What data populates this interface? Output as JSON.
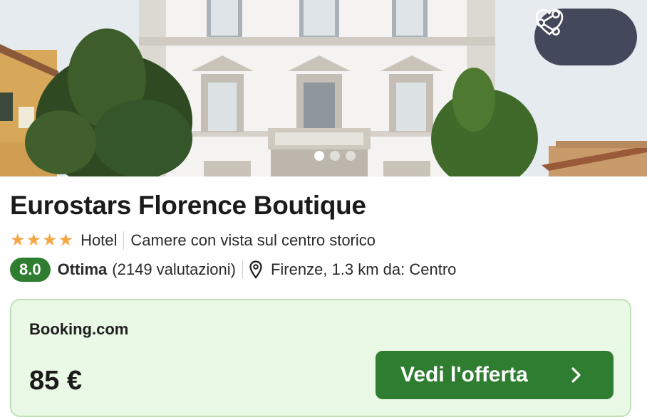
{
  "hotel": {
    "name": "Eurostars Florence Boutique",
    "star_count": 4,
    "type_label": "Hotel",
    "tagline": "Camere con vista sul centro storico"
  },
  "rating": {
    "score": "8.0",
    "label": "Ottima",
    "reviews": "(2149 valutazioni)",
    "location": "Firenze, 1.3 km da: Centro"
  },
  "gallery": {
    "slide_count": 3,
    "active_index": 0
  },
  "actions": {
    "share_icon": "share-icon",
    "favorite_icon": "heart-icon"
  },
  "offer": {
    "provider": "Booking.com",
    "price": "85 €",
    "cta_label": "Vedi l'offerta"
  },
  "colors": {
    "accent_green": "#2f7d31",
    "offer_bg": "#eaf8e6",
    "offer_border": "#bfe3b6",
    "star": "#f5a543",
    "action_pill": "#43495a"
  }
}
